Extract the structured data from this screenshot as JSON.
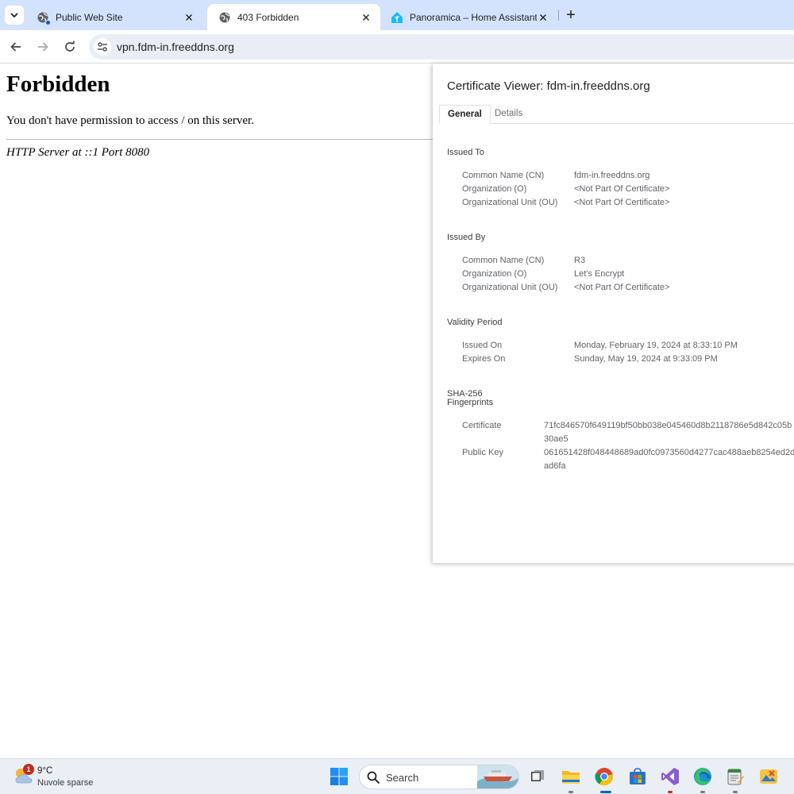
{
  "browser": {
    "tabs": [
      {
        "title": "Public Web Site",
        "active": false
      },
      {
        "title": "403 Forbidden",
        "active": true
      },
      {
        "title": "Panoramica – Home Assistant",
        "active": false
      }
    ],
    "new_tab_glyph": "+",
    "address": "vpn.fdm-in.freeddns.org",
    "icons": [
      "tab-search-icon",
      "globe-icon",
      "home-assistant-icon",
      "close-icon",
      "back-icon",
      "forward-icon",
      "reload-icon",
      "site-info-icon"
    ]
  },
  "page": {
    "heading": "Forbidden",
    "message": "You don't have permission to access / on this server.",
    "address": "HTTP Server at ::1 Port 8080"
  },
  "certificate": {
    "title": "Certificate Viewer: fdm-in.freeddns.org",
    "tabs": [
      "General",
      "Details"
    ],
    "issued_to": {
      "heading": "Issued To",
      "rows": [
        {
          "label": "Common Name (CN)",
          "value": "fdm-in.freeddns.org"
        },
        {
          "label": "Organization (O)",
          "value": "<Not Part Of Certificate>"
        },
        {
          "label": "Organizational Unit (OU)",
          "value": "<Not Part Of Certificate>"
        }
      ]
    },
    "issued_by": {
      "heading": "Issued By",
      "rows": [
        {
          "label": "Common Name (CN)",
          "value": "R3"
        },
        {
          "label": "Organization (O)",
          "value": "Let's Encrypt"
        },
        {
          "label": "Organizational Unit (OU)",
          "value": "<Not Part Of Certificate>"
        }
      ]
    },
    "validity": {
      "heading": "Validity Period",
      "rows": [
        {
          "label": "Issued On",
          "value": "Monday, February 19, 2024 at 8:33:10 PM"
        },
        {
          "label": "Expires On",
          "value": "Sunday, May 19, 2024 at 9:33:09 PM"
        }
      ]
    },
    "fingerprints": {
      "heading_line1": "SHA-256",
      "heading_line2": "Fingerprints",
      "rows": [
        {
          "label": "Certificate",
          "line1": "71fc846570f649119bf50bb038e045460d8b2118786e5d842c05b",
          "line2": "30ae5"
        },
        {
          "label": "Public Key",
          "line1": "061651428f048448689ad0fc0973560d4277cac488aeb8254ed2d",
          "line2": "ad6fa"
        }
      ]
    }
  },
  "taskbar": {
    "weather_badge": "1",
    "temperature": "9°C",
    "condition": "Nuvole sparse",
    "search_label": "Search",
    "apps": [
      "task-view-icon",
      "file-explorer-icon",
      "chrome-icon",
      "store-icon",
      "visual-studio-icon",
      "edge-icon",
      "notepad-icon",
      "photos-icon"
    ]
  },
  "colors": {
    "tabstrip": "#d3e3fd",
    "omnibox": "#e9eef6",
    "taskbar": "#eaeef5",
    "weather_badge": "#c42b1c"
  }
}
